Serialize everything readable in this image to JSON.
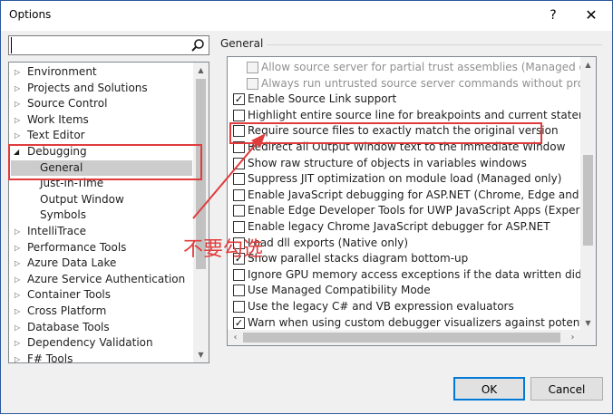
{
  "window": {
    "title": "Options",
    "help_glyph": "?",
    "close_glyph": "✕"
  },
  "search": {
    "placeholder": "",
    "value": ""
  },
  "tree": {
    "items": [
      {
        "label": "Environment",
        "state": "collapsed"
      },
      {
        "label": "Projects and Solutions",
        "state": "collapsed"
      },
      {
        "label": "Source Control",
        "state": "collapsed"
      },
      {
        "label": "Work Items",
        "state": "collapsed"
      },
      {
        "label": "Text Editor",
        "state": "collapsed"
      },
      {
        "label": "Debugging",
        "state": "expanded"
      },
      {
        "label": "General",
        "state": "child",
        "selected": true
      },
      {
        "label": "Just-In-Time",
        "state": "child"
      },
      {
        "label": "Output Window",
        "state": "child"
      },
      {
        "label": "Symbols",
        "state": "child"
      },
      {
        "label": "IntelliTrace",
        "state": "collapsed"
      },
      {
        "label": "Performance Tools",
        "state": "collapsed"
      },
      {
        "label": "Azure Data Lake",
        "state": "collapsed"
      },
      {
        "label": "Azure Service Authentication",
        "state": "collapsed"
      },
      {
        "label": "Container Tools",
        "state": "collapsed"
      },
      {
        "label": "Cross Platform",
        "state": "collapsed"
      },
      {
        "label": "Database Tools",
        "state": "collapsed"
      },
      {
        "label": "Dependency Validation",
        "state": "collapsed"
      },
      {
        "label": "F# Tools",
        "state": "collapsed"
      }
    ]
  },
  "section": {
    "title": "General"
  },
  "options": [
    {
      "label": "Allow source server for partial trust assemblies (Managed only)",
      "checked": false,
      "disabled": true,
      "indent": true
    },
    {
      "label": "Always run untrusted source server commands without prompting",
      "checked": false,
      "disabled": true,
      "indent": true
    },
    {
      "label": "Enable Source Link support",
      "checked": true,
      "disabled": false,
      "indent": false
    },
    {
      "label": "Highlight entire source line for breakpoints and current statement (C++",
      "checked": false,
      "disabled": false,
      "indent": false
    },
    {
      "label": "Require source files to exactly match the original version",
      "checked": false,
      "disabled": false,
      "indent": false
    },
    {
      "label": "Redirect all Output Window text to the Immediate Window",
      "checked": false,
      "disabled": false,
      "indent": false
    },
    {
      "label": "Show raw structure of objects in variables windows",
      "checked": false,
      "disabled": false,
      "indent": false
    },
    {
      "label": "Suppress JIT optimization on module load (Managed only)",
      "checked": false,
      "disabled": false,
      "indent": false
    },
    {
      "label": "Enable JavaScript debugging for ASP.NET (Chrome, Edge and IE)",
      "checked": false,
      "disabled": false,
      "indent": false
    },
    {
      "label": "Enable Edge Developer Tools for UWP JavaScript Apps (Experimental",
      "checked": false,
      "disabled": false,
      "indent": false
    },
    {
      "label": "Enable legacy Chrome JavaScript debugger for ASP.NET",
      "checked": false,
      "disabled": false,
      "indent": false
    },
    {
      "label": "Load dll exports (Native only)",
      "checked": false,
      "disabled": false,
      "indent": false
    },
    {
      "label": "Show parallel stacks diagram bottom-up",
      "checked": true,
      "disabled": false,
      "indent": false
    },
    {
      "label": "Ignore GPU memory access exceptions if the data written didn't chang",
      "checked": false,
      "disabled": false,
      "indent": false
    },
    {
      "label": "Use Managed Compatibility Mode",
      "checked": false,
      "disabled": false,
      "indent": false
    },
    {
      "label": "Use the legacy C# and VB expression evaluators",
      "checked": false,
      "disabled": false,
      "indent": false
    },
    {
      "label": "Warn when using custom debugger visualizers against potentially uns",
      "checked": true,
      "disabled": false,
      "indent": false
    }
  ],
  "annotation": {
    "text": "不要勾选",
    "color": "#e03c3c"
  },
  "buttons": {
    "ok": "OK",
    "cancel": "Cancel"
  },
  "colors": {
    "accent": "#0078d7",
    "selection": "#cccccc",
    "annotation": "#e03c3c"
  }
}
